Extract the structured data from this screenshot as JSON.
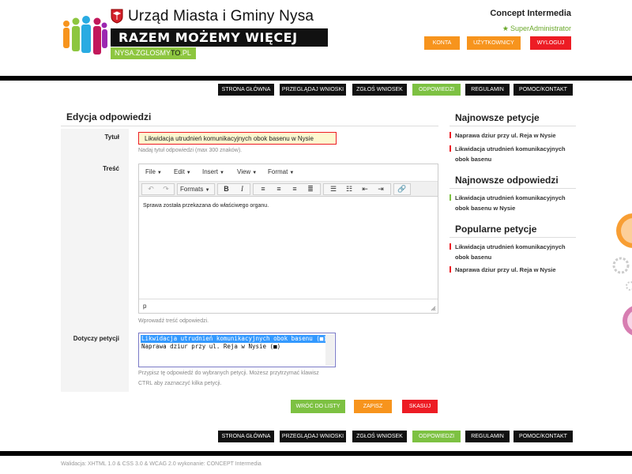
{
  "header": {
    "city_title": "Urząd Miasta i Gminy Nysa",
    "slogan": "RAZEM MOŻEMY WIĘCEJ",
    "site_link_pre": "NYSA.ZGLOSMY",
    "site_link_hl": "TO",
    "site_link_post": ".PL",
    "company": "Concept Intermedia",
    "role": "SuperAdministrator",
    "buttons": {
      "accounts": "KONTA",
      "users": "UŻYTKOWNICY",
      "logout": "WYLOGUJ"
    }
  },
  "nav": {
    "items": [
      "STRONA GŁÓWNA",
      "PRZEGLĄDAJ WNIOSKI",
      "ZGŁOŚ WNIOSEK",
      "ODPOWIEDZI",
      "REGULAMIN",
      "POMOC/KONTAKT"
    ],
    "active": "ODPOWIEDZI"
  },
  "main": {
    "title": "Edycja odpowiedzi",
    "fields": {
      "title_label": "Tytuł",
      "title_value": "Likwidacja utrudnień komunikacyjnych obok basenu w Nysie",
      "title_hint": "Nadaj tytuł odpowiedzi (max 300 znaków).",
      "content_label": "Treść",
      "content_hint": "Wprowadź treść odpowiedzi.",
      "petition_label": "Dotyczy petycji",
      "petition_hint_1": "Przypisz tę odpowiedź do wybranych petycji. Możesz przytrzymać klawisz",
      "petition_hint_2": "CTRL aby zaznaczyć kilka petycji."
    },
    "editor": {
      "menus": [
        "File",
        "Edit",
        "Insert",
        "View",
        "Format"
      ],
      "formats_label": "Formats",
      "content": "Sprawa została przekazana do właściwego organu.",
      "path": "p"
    },
    "petitions": [
      {
        "label": "Likwidacja utrudnień komunikacyjnych obok basenu (■)",
        "selected": true
      },
      {
        "label": "Naprawa dziur przy ul. Reja w Nysie (■)",
        "selected": false
      }
    ],
    "buttons": {
      "back": "WRÓĆ DO LISTY",
      "save": "ZAPISZ",
      "delete": "SKASUJ"
    }
  },
  "sidebar": {
    "newest_petitions": {
      "title": "Najnowsze petycje",
      "items": [
        "Naprawa dziur przy ul. Reja w Nysie",
        "Likwidacja utrudnień komunikacyjnych obok basenu"
      ]
    },
    "newest_answers": {
      "title": "Najnowsze odpowiedzi",
      "items": [
        "Likwidacja utrudnień komunikacyjnych obok basenu w Nysie"
      ]
    },
    "popular_petitions": {
      "title": "Popularne petycje",
      "items": [
        "Likwidacja utrudnień komunikacyjnych obok basenu",
        "Naprawa dziur przy ul. Reja w Nysie"
      ]
    }
  },
  "footer": {
    "text": "Walidacja: XHTML 1.0 & CSS 3.0 & WCAG 2.0  wykonanie: CONCEPT Intermedia"
  },
  "colors": {
    "green": "#7dc142",
    "orange": "#f7941d",
    "red": "#ed1c24",
    "black": "#111111"
  }
}
